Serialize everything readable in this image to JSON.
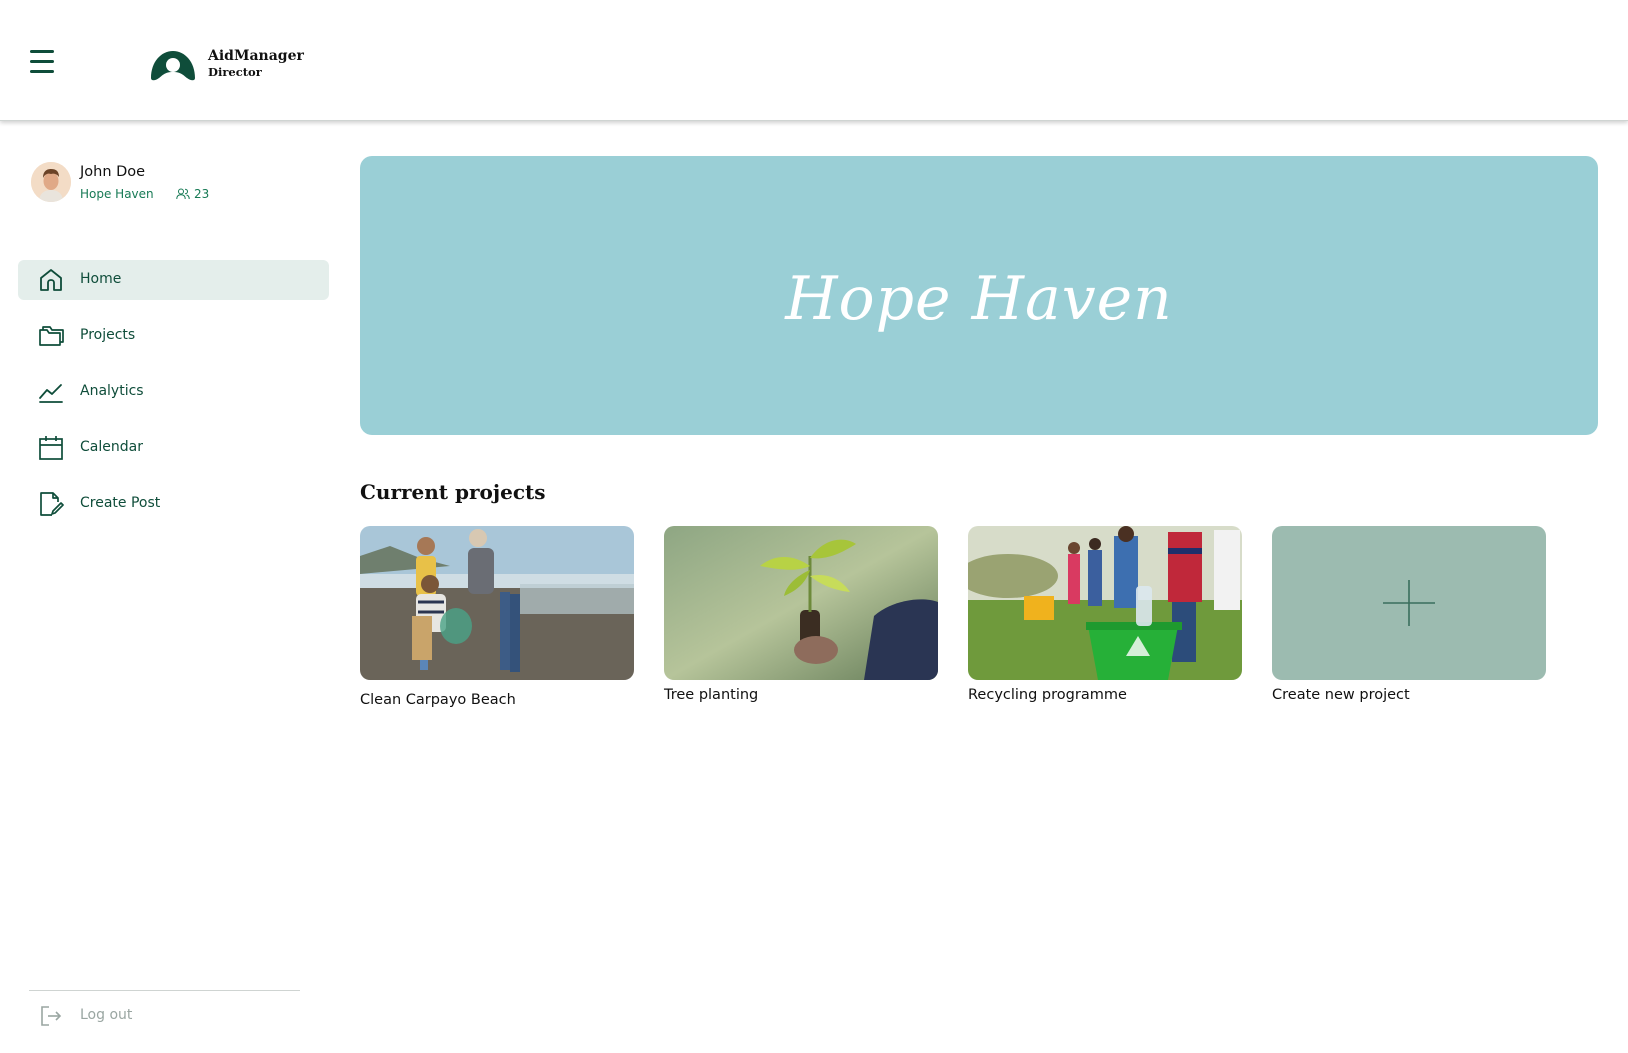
{
  "app": {
    "name": "AidManager",
    "role": "Director"
  },
  "icons": {
    "menu": "hamburger-menu-icon",
    "logo": "aidmanager-logo",
    "members": "users-icon",
    "home": "home-icon",
    "projects": "folder-icon",
    "analytics": "line-chart-icon",
    "calendar": "calendar-icon",
    "create_post": "edit-document-icon",
    "logout": "logout-icon",
    "add": "plus-icon"
  },
  "user": {
    "name": "John Doe",
    "organization": "Hope Haven",
    "members_count": "23"
  },
  "sidebar": {
    "items": [
      {
        "label": "Home",
        "active": true
      },
      {
        "label": "Projects",
        "active": false
      },
      {
        "label": "Analytics",
        "active": false
      },
      {
        "label": "Calendar",
        "active": false
      },
      {
        "label": "Create Post",
        "active": false
      }
    ],
    "logout_label": "Log out"
  },
  "hero": {
    "title": "Hope Haven"
  },
  "projects": {
    "section_title": "Current  projects",
    "cards": [
      {
        "label": "Clean Carpayo Beach",
        "image": "beach-cleanup-photo"
      },
      {
        "label": "Tree planting",
        "image": "seedling-photo"
      },
      {
        "label": "Recycling programme",
        "image": "kids-recycling-photo"
      }
    ],
    "create_label": "Create new project"
  },
  "colors": {
    "brand_dark": "#0f4d3a",
    "brand_green": "#177a55",
    "active_nav_bg": "#e4eeeb",
    "hero_bg": "#9acfd6",
    "new_project_bg": "#9cbbb0"
  }
}
